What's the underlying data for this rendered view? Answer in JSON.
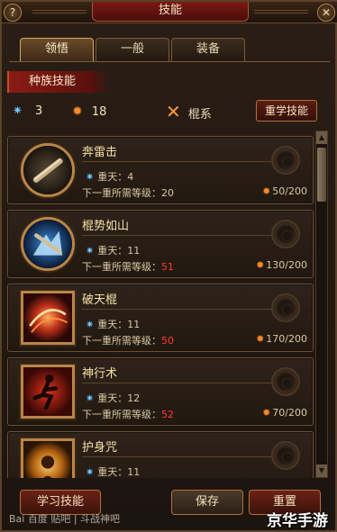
{
  "window": {
    "title": "技能",
    "help_label": "?",
    "close_label": "✕"
  },
  "tabs": [
    {
      "label": "领悟",
      "active": true
    },
    {
      "label": "一般",
      "active": false
    },
    {
      "label": "装备",
      "active": false
    }
  ],
  "category_banner": "种族技能",
  "stats": {
    "star_points": "3",
    "maple_points": "18",
    "class_label": "棍系",
    "relearn_button": "重学技能"
  },
  "skills": [
    {
      "name": "奔雷击",
      "rank_label": "重天：4",
      "req_label": "下一重所需等级：",
      "req_level": "20",
      "req_red": false,
      "cost": "50/200",
      "icon": "staff-icon"
    },
    {
      "name": "棍势如山",
      "rank_label": "重天：11",
      "req_label": "下一重所需等级：",
      "req_level": "51",
      "req_red": true,
      "cost": "130/200",
      "icon": "mountain-strike-icon"
    },
    {
      "name": "破天棍",
      "rank_label": "重天：11",
      "req_label": "下一重所需等级：",
      "req_level": "50",
      "req_red": true,
      "cost": "170/200",
      "icon": "sky-breaker-icon"
    },
    {
      "name": "神行术",
      "rank_label": "重天：12",
      "req_label": "下一重所需等级：",
      "req_level": "52",
      "req_red": true,
      "cost": "70/200",
      "icon": "swift-step-icon"
    },
    {
      "name": "护身咒",
      "rank_label": "重天：11",
      "req_label": "",
      "req_level": "",
      "req_red": false,
      "cost": "",
      "icon": "guard-spell-icon"
    }
  ],
  "buttons": {
    "learn": "学习技能",
    "save": "保存",
    "reset": "重置"
  },
  "watermarks": {
    "left": "Bai 百度 贴吧 | 斗战神吧",
    "right": "京华手游"
  },
  "colors": {
    "accent_red": "#ff3a2a",
    "gold": "#f4e1a8",
    "star_blue": "#6fc2ff",
    "maple_orange": "#ff8a2a"
  }
}
